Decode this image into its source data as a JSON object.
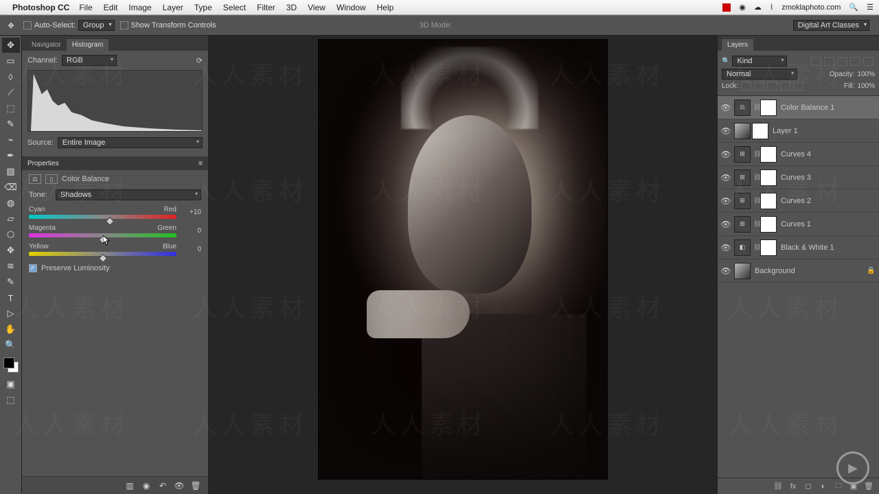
{
  "menubar": {
    "app": "Photoshop CC",
    "items": [
      "File",
      "Edit",
      "Image",
      "Layer",
      "Type",
      "Select",
      "Filter",
      "3D",
      "View",
      "Window",
      "Help"
    ],
    "right_url": "zmoklaphoto.com"
  },
  "options_bar": {
    "auto_select": "Auto-Select:",
    "group": "Group",
    "show_transform": "Show Transform Controls",
    "mode_3d": "3D Mode:",
    "workspace_switcher": "Digital Art Classes"
  },
  "nav_panel": {
    "tabs": [
      "Navigator",
      "Histogram"
    ],
    "channel_label": "Channel:",
    "channel_value": "RGB",
    "source_label": "Source:",
    "source_value": "Entire Image"
  },
  "properties": {
    "title": "Properties",
    "adj_name": "Color Balance",
    "tone_label": "Tone:",
    "tone_value": "Shadows",
    "sliders": [
      {
        "left": "Cyan",
        "right": "Red",
        "value": "+10",
        "pos": 55
      },
      {
        "left": "Magenta",
        "right": "Green",
        "value": "0",
        "pos": 50
      },
      {
        "left": "Yellow",
        "right": "Blue",
        "value": "0",
        "pos": 50
      }
    ],
    "preserve": "Preserve Luminosity"
  },
  "layers_panel": {
    "title": "Layers",
    "kind": "Kind",
    "blend_mode": "Normal",
    "opacity_label": "Opacity:",
    "opacity_value": "100%",
    "lock_label": "Lock:",
    "fill_label": "Fill:",
    "fill_value": "100%",
    "layers": [
      {
        "name": "Color Balance 1",
        "adj": "⚖",
        "mask": true,
        "sel": true
      },
      {
        "name": "Layer 1",
        "adj": "",
        "mask": true
      },
      {
        "name": "Curves 4",
        "adj": "⊞",
        "mask": true
      },
      {
        "name": "Curves 3",
        "adj": "⊞",
        "mask": true
      },
      {
        "name": "Curves 2",
        "adj": "⊞",
        "mask": true
      },
      {
        "name": "Curves 1",
        "adj": "⊞",
        "mask": true
      },
      {
        "name": "Black & White 1",
        "adj": "◧",
        "mask": true
      },
      {
        "name": "Background",
        "adj": "",
        "mask": false,
        "locked": true
      }
    ]
  },
  "tools": [
    "✥",
    "▭",
    "◊",
    "⟋",
    "⬚",
    "✎",
    "⌁",
    "✒",
    "▨",
    "⌫",
    "◍",
    "▱",
    "⬡",
    "✥",
    "≋",
    "✎",
    "T",
    "▷",
    "✋",
    "🔍"
  ],
  "watermark_zh": "人人素材"
}
